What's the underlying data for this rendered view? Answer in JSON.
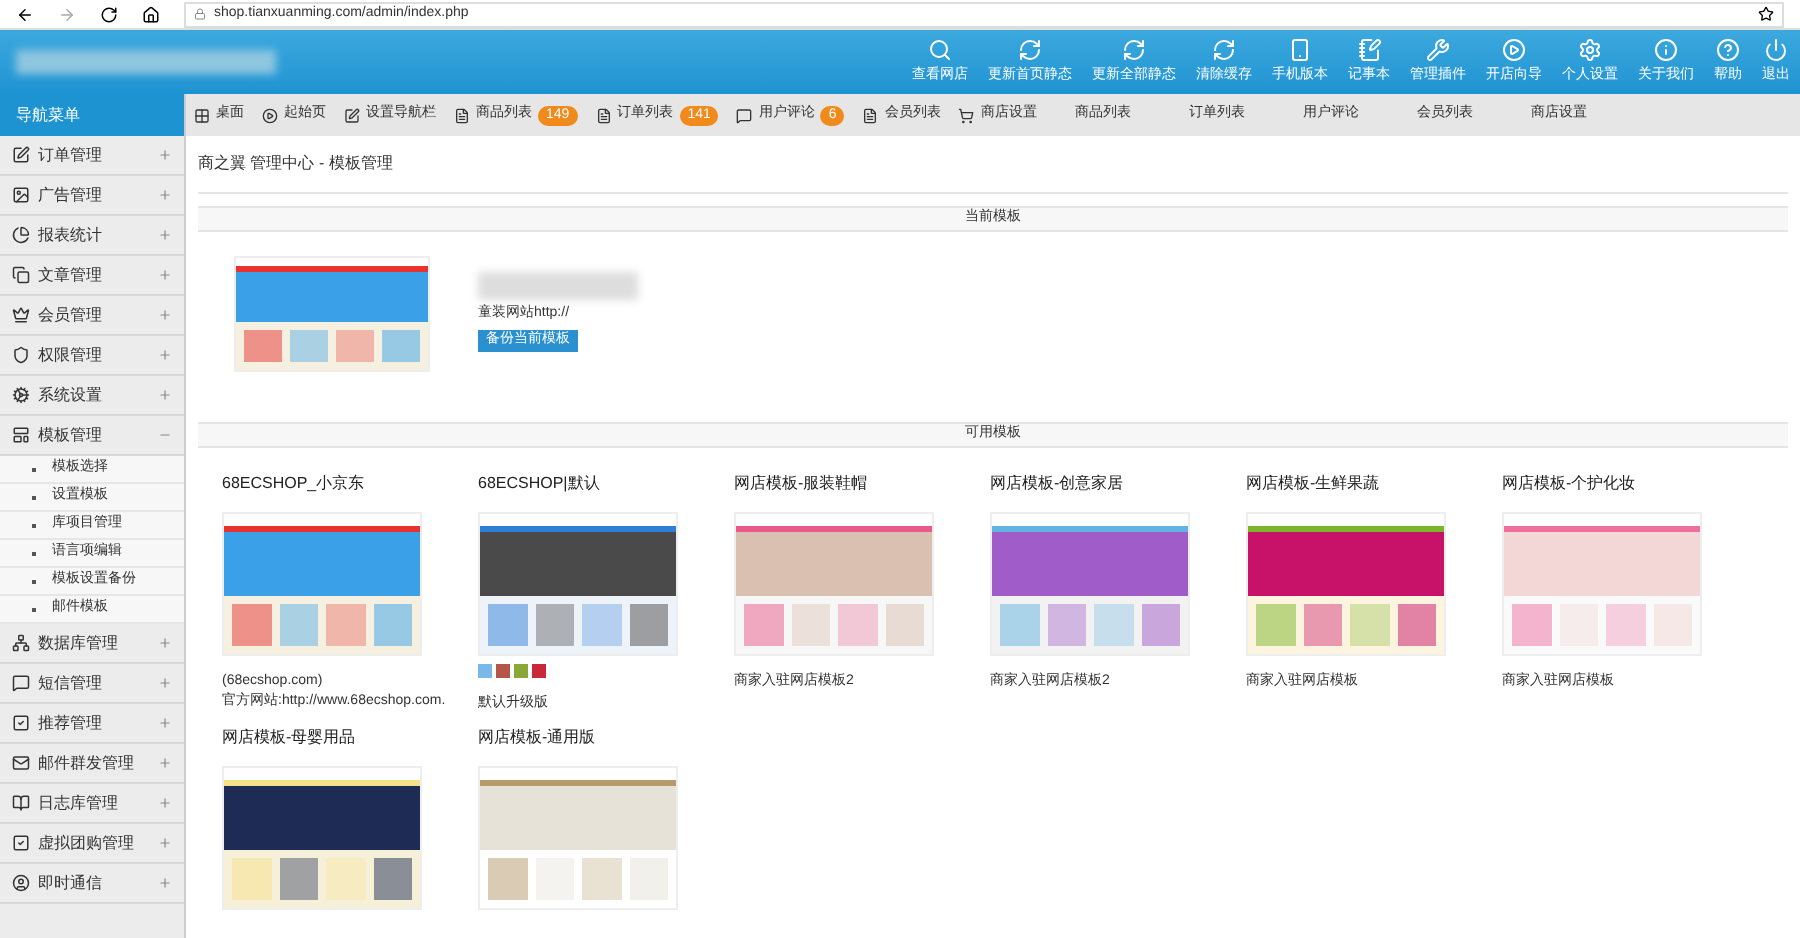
{
  "browser": {
    "url": "shop.tianxuanming.com/admin/index.php"
  },
  "header": {
    "tools": [
      {
        "label": "查看网店"
      },
      {
        "label": "更新首页静态"
      },
      {
        "label": "更新全部静态"
      },
      {
        "label": "清除缓存"
      },
      {
        "label": "手机版本"
      },
      {
        "label": "记事本"
      },
      {
        "label": "管理插件"
      },
      {
        "label": "开店向导"
      },
      {
        "label": "个人设置"
      },
      {
        "label": "关于我们"
      },
      {
        "label": "帮助"
      },
      {
        "label": "退出"
      }
    ]
  },
  "sidebar": {
    "title": "导航菜单",
    "items": [
      {
        "label": "订单管理",
        "expanded": false
      },
      {
        "label": "广告管理",
        "expanded": false
      },
      {
        "label": "报表统计",
        "expanded": false
      },
      {
        "label": "文章管理",
        "expanded": false
      },
      {
        "label": "会员管理",
        "expanded": false
      },
      {
        "label": "权限管理",
        "expanded": false
      },
      {
        "label": "系统设置",
        "expanded": false
      },
      {
        "label": "模板管理",
        "expanded": true,
        "children": [
          {
            "label": "模板选择"
          },
          {
            "label": "设置模板"
          },
          {
            "label": "库项目管理"
          },
          {
            "label": "语言项编辑"
          },
          {
            "label": "模板设置备份"
          },
          {
            "label": "邮件模板"
          }
        ]
      },
      {
        "label": "数据库管理",
        "expanded": false
      },
      {
        "label": "短信管理",
        "expanded": false
      },
      {
        "label": "推荐管理",
        "expanded": false
      },
      {
        "label": "邮件群发管理",
        "expanded": false
      },
      {
        "label": "日志库管理",
        "expanded": false
      },
      {
        "label": "虚拟团购管理",
        "expanded": false
      },
      {
        "label": "即时通信",
        "expanded": false
      }
    ]
  },
  "tabs": [
    {
      "label": "桌面",
      "kind": "shortcut"
    },
    {
      "label": "起始页",
      "kind": "shortcut"
    },
    {
      "label": "设置导航栏",
      "kind": "shortcut"
    },
    {
      "label": "商品列表",
      "kind": "shortcut",
      "badge": "149"
    },
    {
      "label": "订单列表",
      "kind": "shortcut",
      "badge": "141"
    },
    {
      "label": "用户评论",
      "kind": "shortcut",
      "badge": "6"
    },
    {
      "label": "会员列表",
      "kind": "shortcut"
    },
    {
      "label": "商店设置",
      "kind": "shortcut"
    },
    {
      "label": "商品列表",
      "kind": "plain"
    },
    {
      "label": "订单列表",
      "kind": "plain"
    },
    {
      "label": "用户评论",
      "kind": "plain"
    },
    {
      "label": "会员列表",
      "kind": "plain"
    },
    {
      "label": "商店设置",
      "kind": "plain"
    }
  ],
  "breadcrumb": "商之翼 管理中心 - 模板管理",
  "current_section": {
    "title": "当前模板",
    "description": "童装网站http://",
    "button": "备份当前模板"
  },
  "available_section": {
    "title": "可用模板",
    "templates": [
      {
        "name": "68ECSHOP_小京东",
        "captions": [
          "(68ecshop.com)",
          "官方网站:http://www.68ecshop.com."
        ]
      },
      {
        "name": "68ECSHOP|默认",
        "captions": [
          "默认升级版"
        ],
        "swatches": [
          {
            "color": "#7ab8e8"
          },
          {
            "color": "#b5564a"
          },
          {
            "color": "#8aa83a"
          },
          {
            "color": "#c8283a"
          }
        ]
      },
      {
        "name": "网店模板-服装鞋帽",
        "captions": [
          "商家入驻网店模板2"
        ]
      },
      {
        "name": "网店模板-创意家居",
        "captions": [
          "商家入驻网店模板2"
        ]
      },
      {
        "name": "网店模板-生鲜果蔬",
        "captions": [
          "商家入驻网店模板"
        ]
      },
      {
        "name": "网店模板-个护化妆",
        "captions": [
          "商家入驻网店模板"
        ]
      },
      {
        "name": "网店模板-母婴用品"
      },
      {
        "name": "网店模板-通用版"
      }
    ]
  }
}
